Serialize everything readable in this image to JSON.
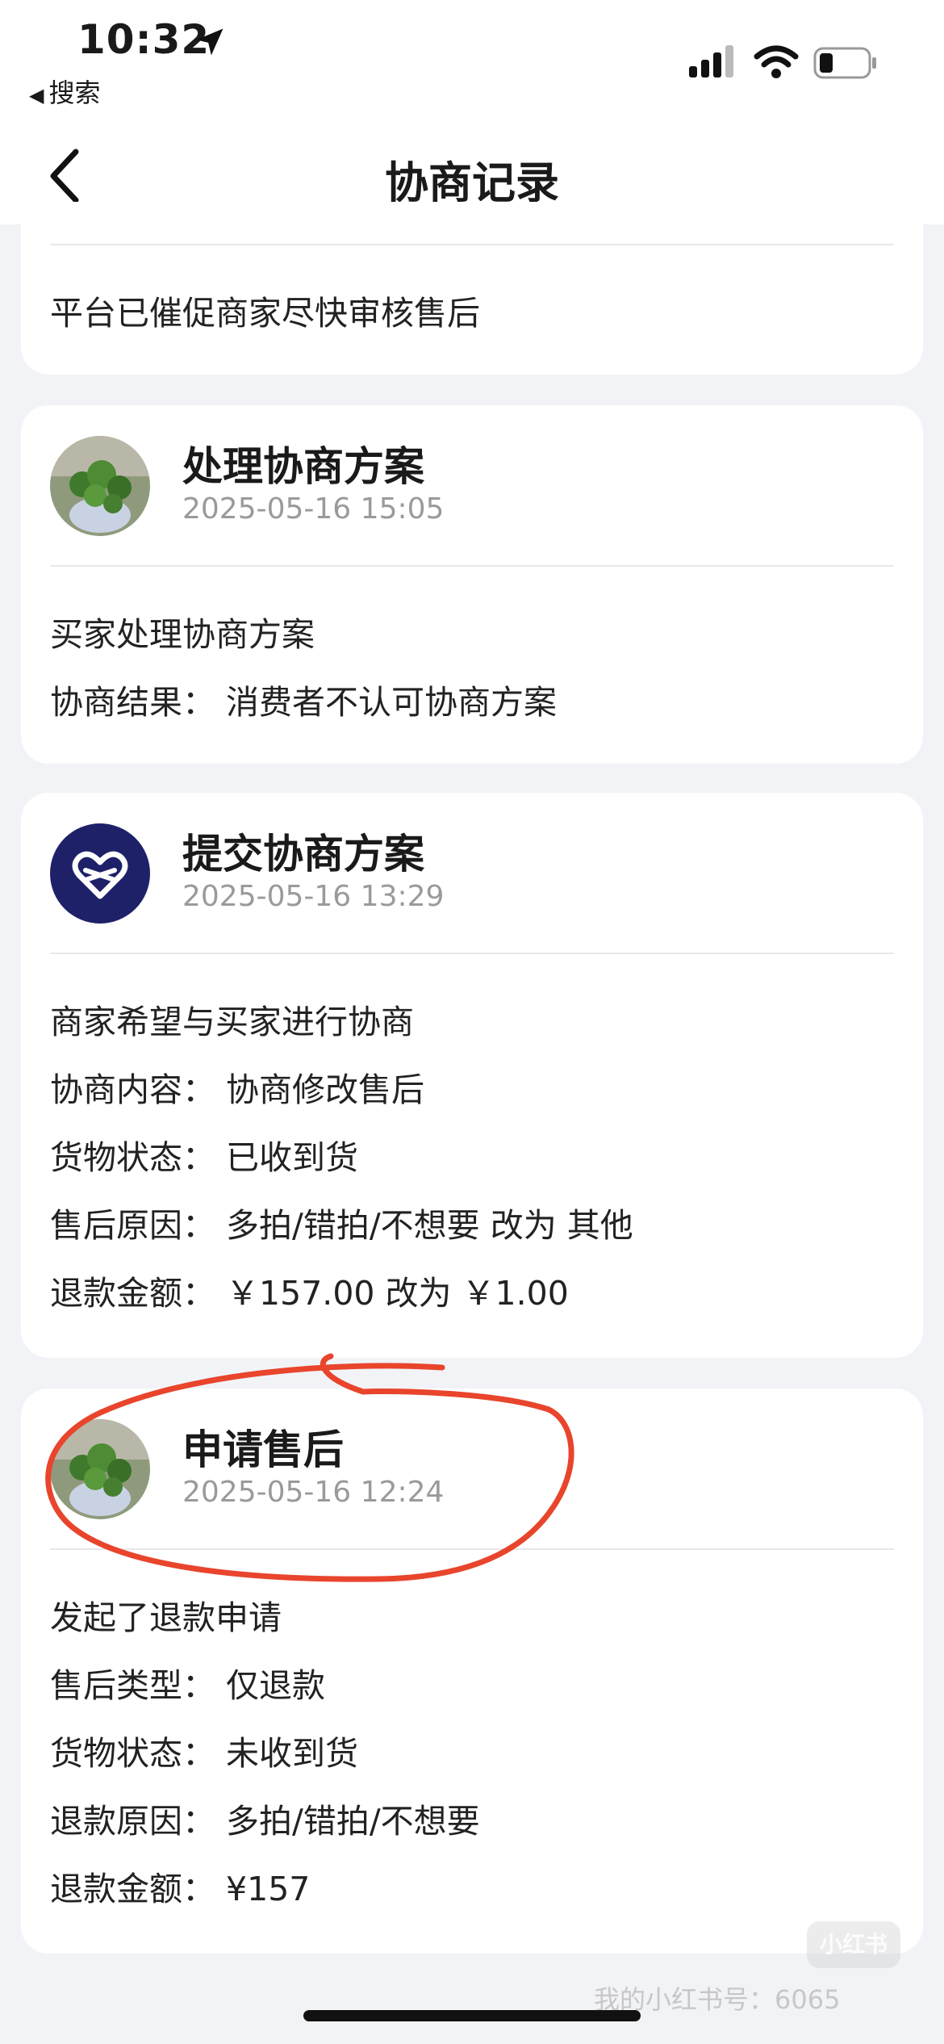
{
  "status": {
    "time": "10:32",
    "back_app": "搜索"
  },
  "nav": {
    "title": "协商记录"
  },
  "top_card": {
    "text": "平台已催促商家尽快审核售后"
  },
  "records": [
    {
      "title": "处理协商方案",
      "time": "2025-05-16 15:05",
      "avatar": "plant-photo",
      "lines": [
        "买家处理协商方案",
        "协商结果： 消费者不认可协商方案"
      ]
    },
    {
      "title": "提交协商方案",
      "time": "2025-05-16 13:29",
      "avatar": "heart-logo",
      "lines": [
        "商家希望与买家进行协商",
        "协商内容： 协商修改售后",
        "货物状态： 已收到货",
        "售后原因： 多拍/错拍/不想要 改为 其他",
        "退款金额： ￥157.00 改为 ￥1.00"
      ]
    },
    {
      "title": "申请售后",
      "time": "2025-05-16 12:24",
      "avatar": "plant-photo",
      "lines": [
        "发起了退款申请",
        "售后类型： 仅退款",
        "货物状态： 未收到货",
        "退款原因： 多拍/错拍/不想要",
        "退款金额： ¥157"
      ]
    }
  ],
  "watermark": {
    "logo": "小红书",
    "text": "我的小红书号：6065"
  },
  "colors": {
    "annotation": "#e8452c",
    "logo_bg": "#1e2168"
  }
}
